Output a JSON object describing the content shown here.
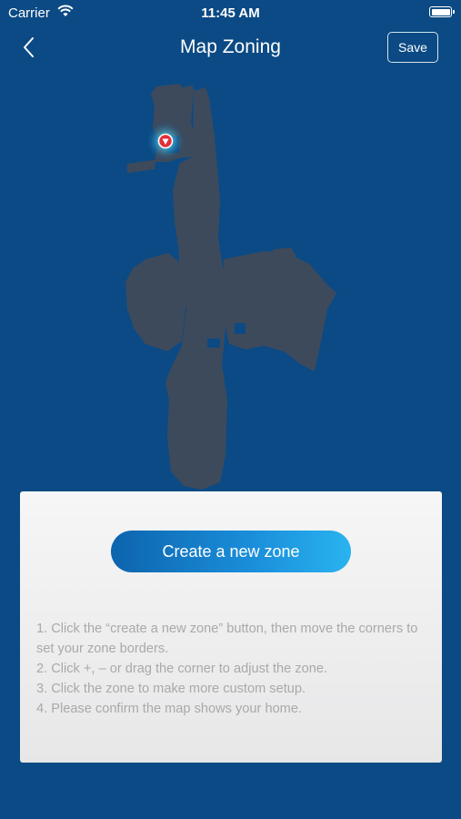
{
  "status_bar": {
    "carrier": "Carrier",
    "time": "11:45 AM"
  },
  "nav": {
    "title": "Map Zoning",
    "save_label": "Save"
  },
  "panel": {
    "create_zone_label": "Create a new zone",
    "instructions": [
      "1. Click the “create a new zone” button, then move the corners to set your zone borders.",
      "2. Click +, – or drag the corner to adjust the zone.",
      "3. Click the zone to make more custom setup.",
      "4. Please confirm the map shows your home."
    ]
  },
  "colors": {
    "background": "#0b4a84",
    "map_fill": "#3d4a5c",
    "robot_marker": "#e0303a",
    "button_start": "#0d64ad",
    "button_end": "#29b3ef"
  },
  "icons": {
    "back": "chevron-left-icon",
    "wifi": "wifi-icon",
    "battery": "battery-icon",
    "robot": "robot-marker-icon"
  }
}
